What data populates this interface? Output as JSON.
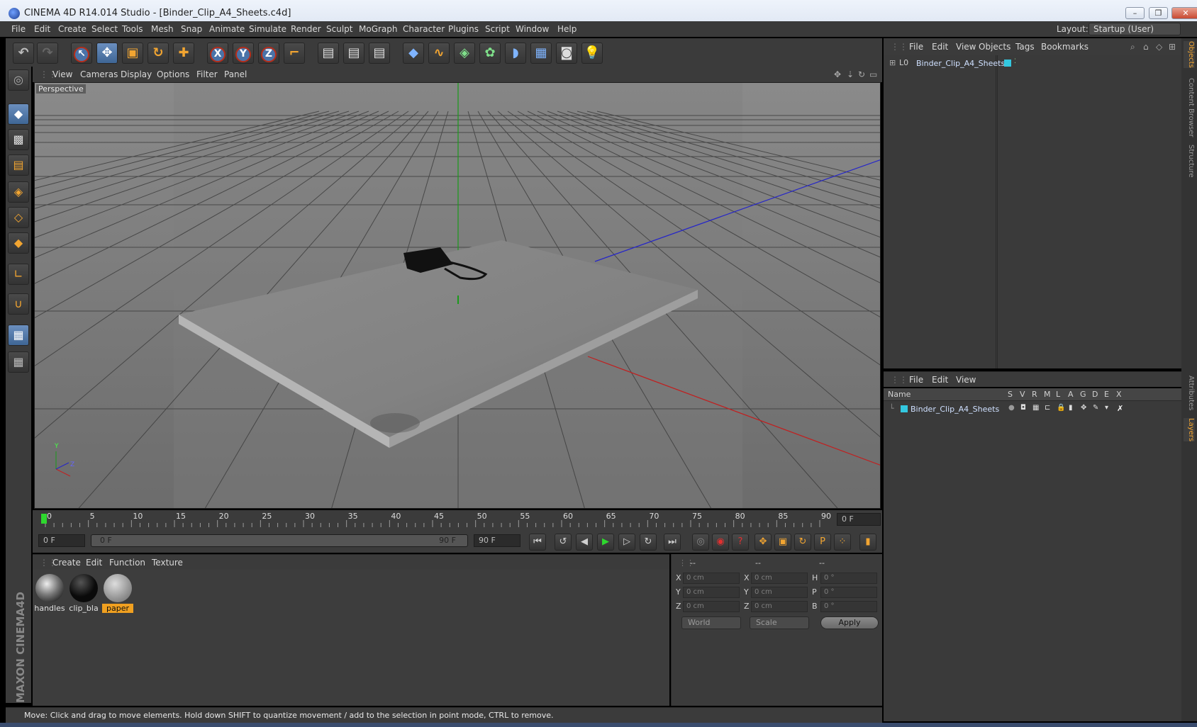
{
  "window": {
    "title": "CINEMA 4D R14.014 Studio - [Binder_Clip_A4_Sheets.c4d]",
    "controls": {
      "minimize": "–",
      "maximize": "❐",
      "close": "✕"
    }
  },
  "menubar": {
    "items": [
      "File",
      "Edit",
      "Create",
      "Select",
      "Tools",
      "Mesh",
      "Snap",
      "Animate",
      "Simulate",
      "Render",
      "Sculpt",
      "MoGraph",
      "Character",
      "Plugins",
      "Script",
      "Window",
      "Help"
    ],
    "layout_label": "Layout:",
    "layout_value": "Startup (User)"
  },
  "viewport": {
    "menu": [
      "View",
      "Cameras",
      "Display",
      "Options",
      "Filter",
      "Panel"
    ],
    "label": "Perspective",
    "axis_y": "Y",
    "axis_z": "Z"
  },
  "timeline": {
    "ticks": [
      "0",
      "5",
      "10",
      "15",
      "20",
      "25",
      "30",
      "35",
      "40",
      "45",
      "50",
      "55",
      "60",
      "65",
      "70",
      "75",
      "80",
      "85",
      "90"
    ],
    "current_frame": "0 F",
    "start_field": "0 F",
    "range_start": "0 F",
    "range_end": "90 F",
    "end_field": "90 F"
  },
  "materials": {
    "menu": [
      "Create",
      "Edit",
      "Function",
      "Texture"
    ],
    "items": [
      {
        "name": "handles",
        "selected": false
      },
      {
        "name": "clip_bla",
        "selected": false
      },
      {
        "name": "paper",
        "selected": true
      }
    ]
  },
  "coordinates": {
    "headers": [
      "--",
      "--",
      "--"
    ],
    "rows": [
      {
        "l1": "X",
        "v1": "0 cm",
        "l2": "X",
        "v2": "0 cm",
        "l3": "H",
        "v3": "0 °"
      },
      {
        "l1": "Y",
        "v1": "0 cm",
        "l2": "Y",
        "v2": "0 cm",
        "l3": "P",
        "v3": "0 °"
      },
      {
        "l1": "Z",
        "v1": "0 cm",
        "l2": "Z",
        "v2": "0 cm",
        "l3": "B",
        "v3": "0 °"
      }
    ],
    "space": "World",
    "mode": "Scale",
    "apply": "Apply"
  },
  "status": "Move: Click and drag to move elements. Hold down SHIFT to quantize movement / add to the selection in point mode, CTRL to remove.",
  "objects": {
    "menu": [
      "File",
      "Edit",
      "View",
      "Objects",
      "Tags",
      "Bookmarks"
    ],
    "items": [
      {
        "name": "Binder_Clip_A4_Sheets",
        "prefix": "L0"
      }
    ]
  },
  "layers": {
    "menu": [
      "File",
      "Edit",
      "View"
    ],
    "columns": [
      "Name",
      "S",
      "V",
      "R",
      "M",
      "L",
      "A",
      "G",
      "D",
      "E",
      "X"
    ],
    "items": [
      {
        "name": "Binder_Clip_A4_Sheets"
      }
    ]
  },
  "sidetabs": [
    "Objects",
    "Content Browser",
    "Structure",
    "Attributes",
    "Layers"
  ],
  "colors": {
    "accent": "#f2a531",
    "selection": "#4a73a8",
    "layer_color": "#33c8e0"
  }
}
